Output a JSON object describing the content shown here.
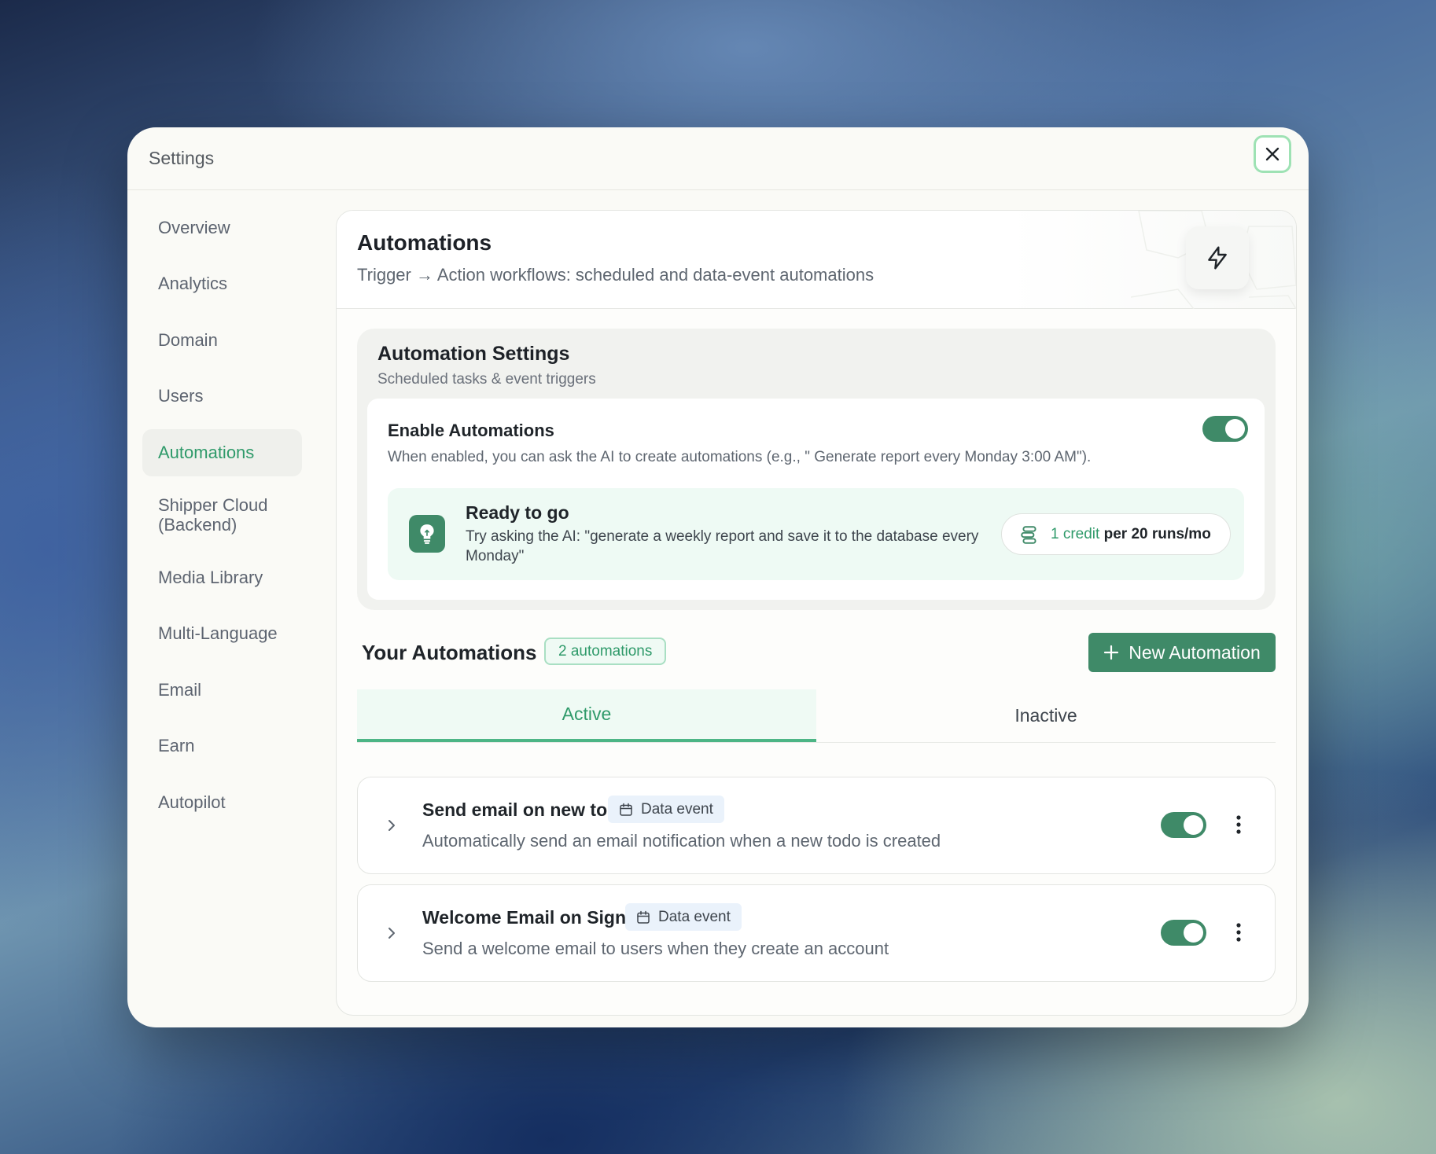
{
  "dialog": {
    "title": "Settings"
  },
  "sidebar": {
    "items": [
      {
        "label": "Overview"
      },
      {
        "label": "Analytics"
      },
      {
        "label": "Domain"
      },
      {
        "label": "Users"
      },
      {
        "label": "Automations",
        "active": true
      },
      {
        "label": "Shipper Cloud (Backend)"
      },
      {
        "label": "Media Library"
      },
      {
        "label": "Multi-Language"
      },
      {
        "label": "Email"
      },
      {
        "label": "Earn"
      },
      {
        "label": "Autopilot"
      }
    ]
  },
  "page": {
    "title": "Automations",
    "subtitle": "Trigger → Action workflows: scheduled and data-event automations",
    "icon": "lightning-icon"
  },
  "automation_settings": {
    "title": "Automation Settings",
    "subtitle": "Scheduled tasks & event triggers",
    "enable_title": "Enable Automations",
    "enable_desc": "When enabled, you can ask the AI to create automations (e.g., \" Generate report every Monday 3:00 AM\").",
    "enabled": true,
    "ready_title": "Ready to go",
    "ready_desc": "Try asking the AI: \"generate a weekly report and save it to the database every Monday\"",
    "credit_highlight": "1 credit",
    "credit_rest": "per 20 runs/mo"
  },
  "your_automations": {
    "title": "Your Automations",
    "count_badge": "2 automations",
    "new_button": "New Automation"
  },
  "tabs": [
    {
      "label": "Active",
      "active": true
    },
    {
      "label": "Inactive",
      "active": false
    }
  ],
  "automations": [
    {
      "title": "Send email on new todo",
      "badge": "Data event",
      "description": "Automatically send an email notification when a new todo is created",
      "enabled": true
    },
    {
      "title": "Welcome Email on Signup",
      "badge": "Data event",
      "description": "Send a welcome email to users when they create an account",
      "enabled": true
    }
  ],
  "colors": {
    "accent": "#3f8a68",
    "accent_text": "#2f9a6a",
    "panel": "#fafaf6"
  }
}
